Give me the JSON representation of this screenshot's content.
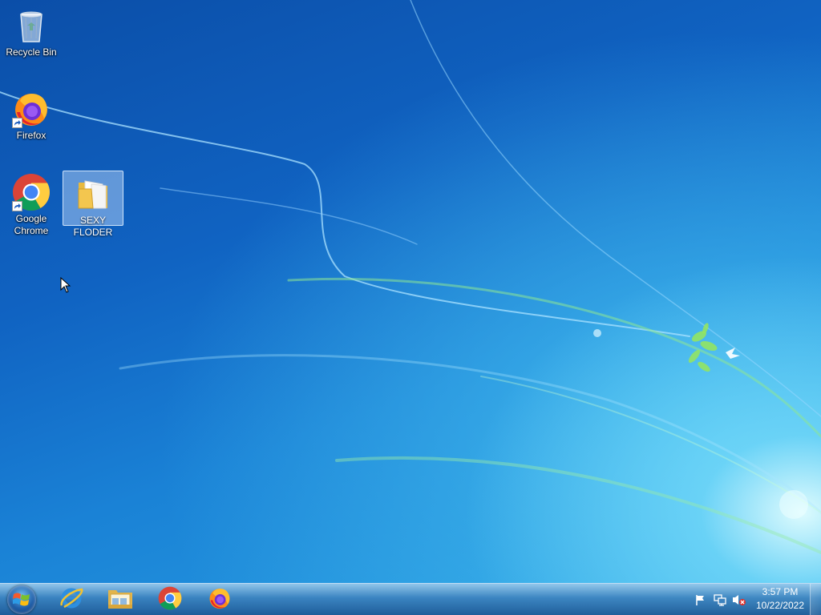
{
  "desktop": {
    "icons": [
      {
        "label": "Recycle Bin",
        "icon": "recycle-bin-icon"
      },
      {
        "label": "Firefox",
        "icon": "firefox-icon",
        "shortcut": true
      },
      {
        "label": "Google Chrome",
        "icon": "chrome-icon",
        "shortcut": true
      },
      {
        "label": "SEXY FLODER",
        "icon": "folder-icon",
        "selected": true
      }
    ]
  },
  "taskbar": {
    "start": {
      "icon": "windows-logo-icon"
    },
    "pinned": [
      {
        "icon": "internet-explorer-icon"
      },
      {
        "icon": "file-explorer-icon"
      },
      {
        "icon": "chrome-icon"
      },
      {
        "icon": "firefox-icon"
      }
    ],
    "tray": {
      "icons": [
        "action-center-flag-icon",
        "network-icon",
        "volume-muted-icon"
      ],
      "time": "3:57 PM",
      "date": "10/22/2022"
    }
  },
  "colors": {
    "taskbar": "#3c82be",
    "desktop_base": "#1063c2",
    "selection": "#c8e1ff"
  }
}
